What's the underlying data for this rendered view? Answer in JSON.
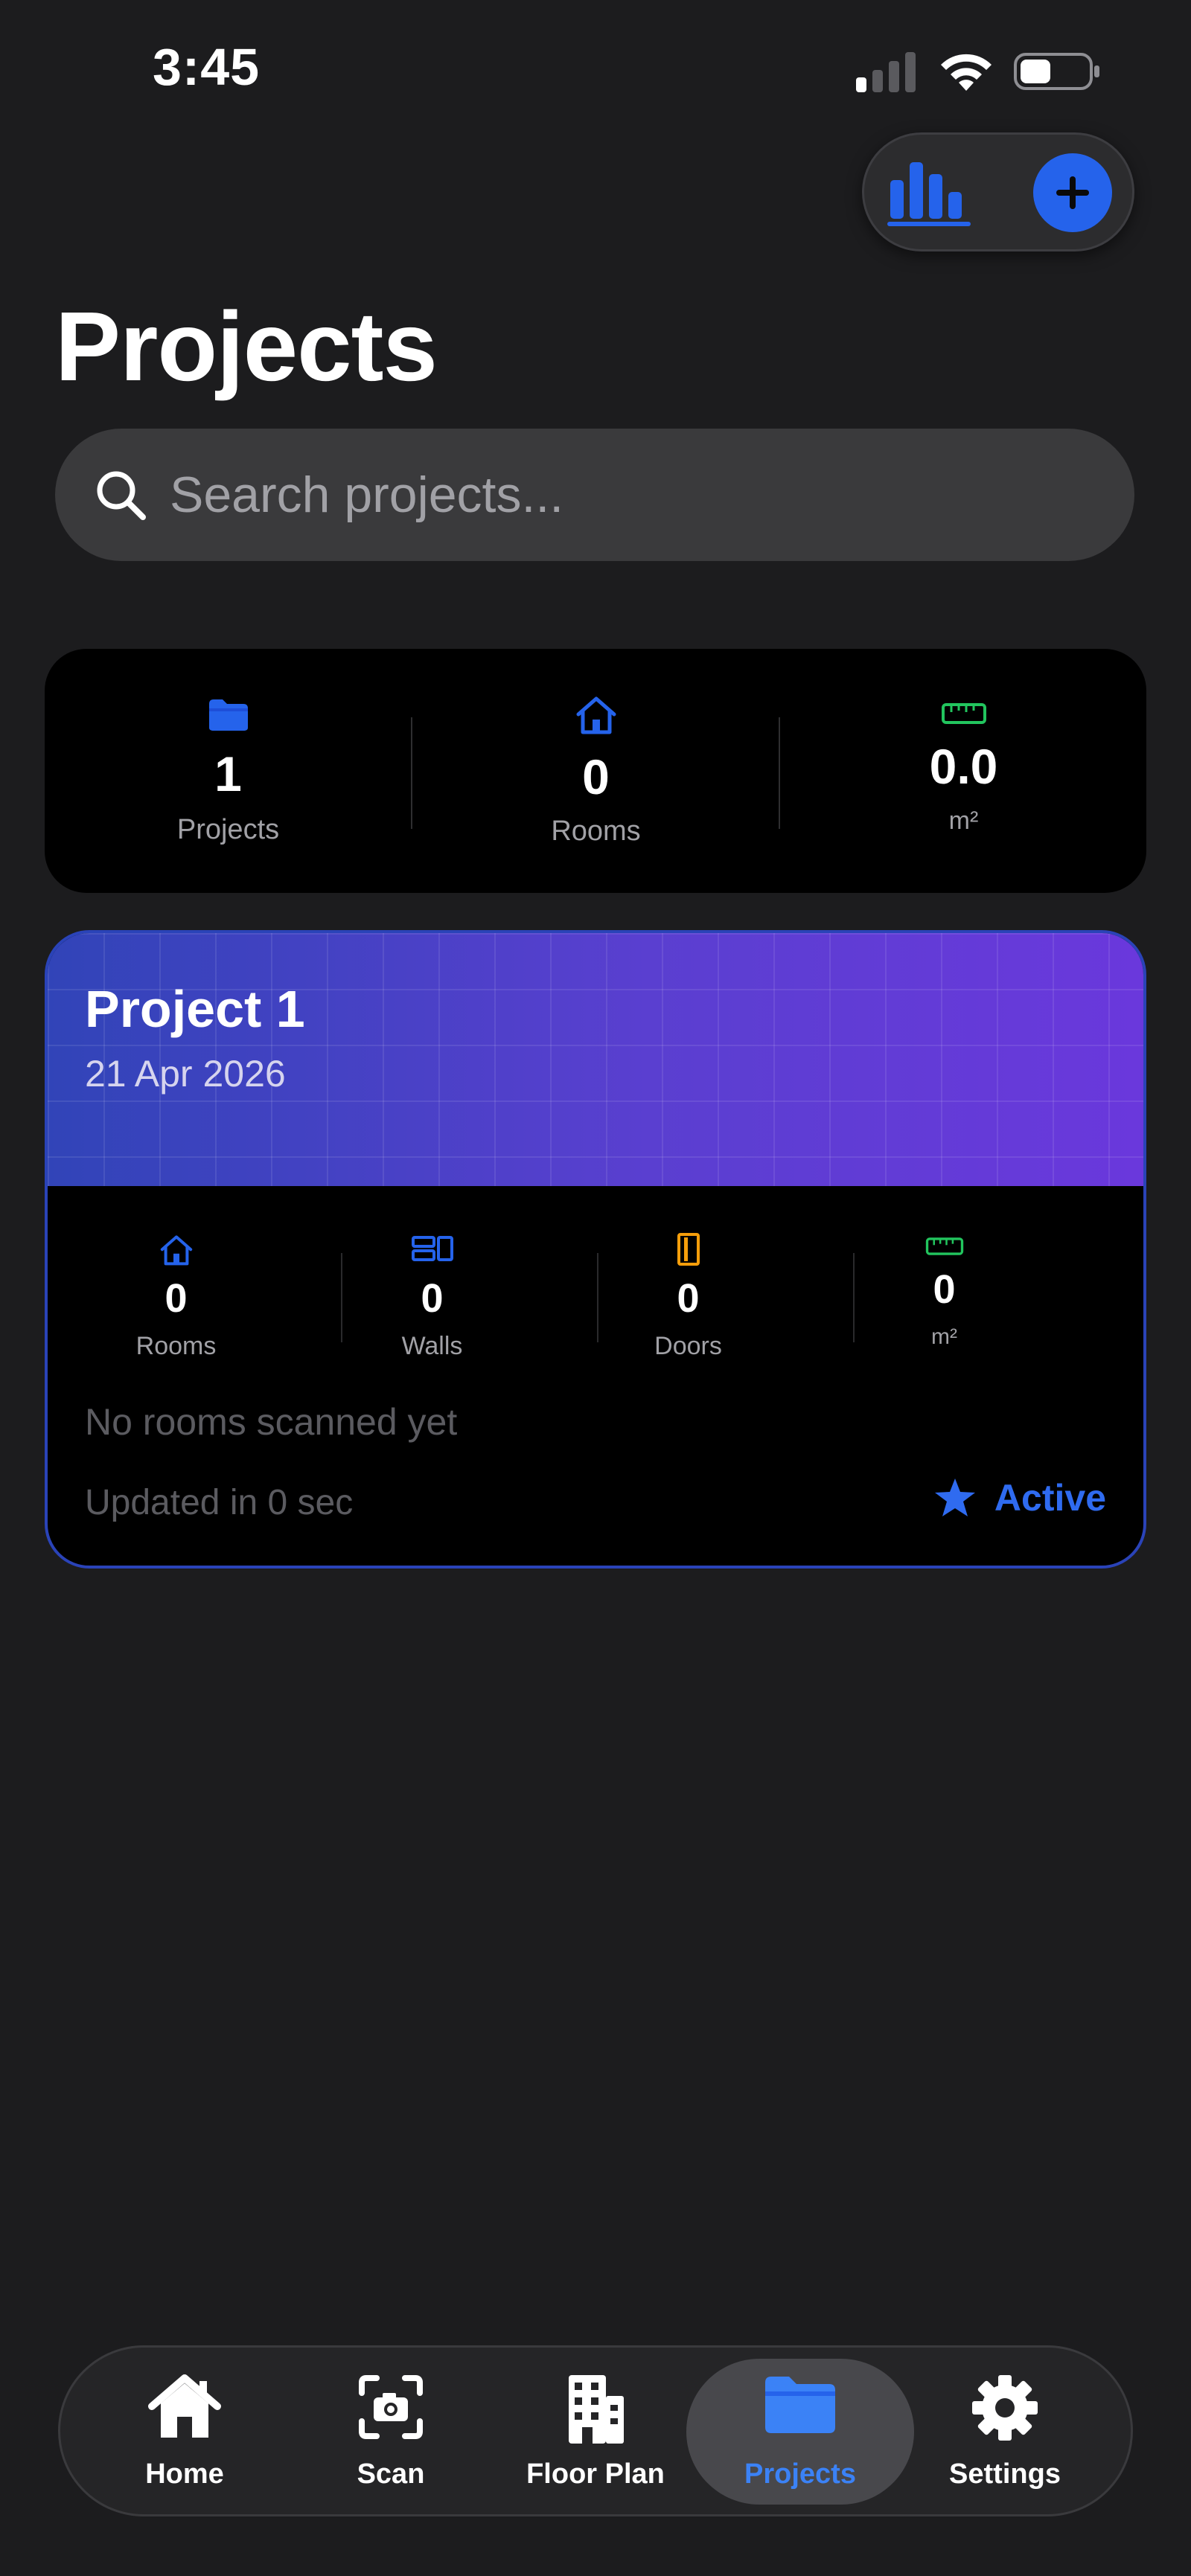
{
  "status_bar": {
    "time": "3:45"
  },
  "header": {
    "title": "Projects"
  },
  "search": {
    "placeholder": "Search projects..."
  },
  "summary_stats": [
    {
      "icon": "folder-icon",
      "value": "1",
      "label": "Projects",
      "color": "#2563eb"
    },
    {
      "icon": "house-icon",
      "value": "0",
      "label": "Rooms",
      "color": "#2563eb"
    },
    {
      "icon": "ruler-icon",
      "value": "0.0",
      "label": "m²",
      "color": "#22c55e"
    }
  ],
  "project": {
    "name": "Project 1",
    "date": "21 Apr 2026",
    "stats": [
      {
        "icon": "house-icon",
        "value": "0",
        "label": "Rooms",
        "color": "#2563eb"
      },
      {
        "icon": "walls-icon",
        "value": "0",
        "label": "Walls",
        "color": "#2563eb"
      },
      {
        "icon": "door-icon",
        "value": "0",
        "label": "Doors",
        "color": "#f59e0b"
      },
      {
        "icon": "ruler-icon",
        "value": "0",
        "label": "m²",
        "color": "#22c55e"
      }
    ],
    "empty_message": "No rooms scanned yet",
    "updated": "Updated in 0 sec",
    "status": "Active"
  },
  "tabs": [
    {
      "label": "Home",
      "icon": "house-icon"
    },
    {
      "label": "Scan",
      "icon": "camera-scan-icon"
    },
    {
      "label": "Floor Plan",
      "icon": "building-icon"
    },
    {
      "label": "Projects",
      "icon": "folder-icon",
      "active": true
    },
    {
      "label": "Settings",
      "icon": "gear-icon"
    }
  ],
  "colors": {
    "accent": "#2563eb",
    "background": "#1c1c1e",
    "card": "#000000",
    "green": "#22c55e",
    "orange": "#f59e0b"
  }
}
